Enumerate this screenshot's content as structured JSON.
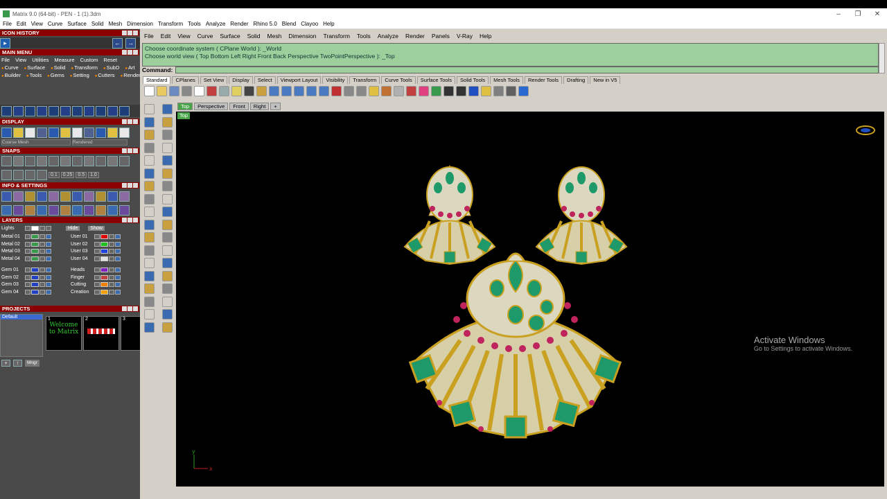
{
  "window": {
    "title": "Matrix 9.0 (64-bit) - PEN - 1 (1).3dm"
  },
  "main_menu_bar": [
    "File",
    "Edit",
    "View",
    "Curve",
    "Surface",
    "Solid",
    "Mesh",
    "Dimension",
    "Transform",
    "Tools",
    "Analyze",
    "Render",
    "Rhino 5.0",
    "Blend",
    "Clayoo",
    "Help"
  ],
  "left_panel": {
    "icon_history": "ICON HISTORY",
    "main_menu": "MAIN MENU",
    "main_menu_row1": [
      "File",
      "View",
      "Utilities",
      "Measure",
      "Custom",
      "Reset"
    ],
    "main_menu_row2": [
      "Curve",
      "Surface",
      "Solid",
      "Transform",
      "SubD",
      "Art"
    ],
    "main_menu_row3": [
      "Builder",
      "Tools",
      "Gems",
      "Setting",
      "Cutters",
      "Render"
    ],
    "display": "DISPLAY",
    "display_mesh": "Coarse Mesh",
    "display_mode": "Rendered",
    "snaps": "SNAPS",
    "snap_values": [
      "0.1",
      "0.25",
      "0.5",
      "1.0"
    ],
    "info_settings": "INFO & SETTINGS",
    "layers": "LAYERS",
    "layer_lights": "Lights",
    "hide": "Hide",
    "show": "Show",
    "layers_left": [
      {
        "name": "Metal 01",
        "color": "#3a9a4c"
      },
      {
        "name": "Metal 02",
        "color": "#3a9a4c"
      },
      {
        "name": "Metal 03",
        "color": "#3a9a4c"
      },
      {
        "name": "Metal 04",
        "color": "#3a9a4c"
      },
      {
        "name": "Gem 01",
        "color": "#2040c0"
      },
      {
        "name": "Gem 02",
        "color": "#2040c0"
      },
      {
        "name": "Gem 03",
        "color": "#2040c0"
      },
      {
        "name": "Gem 04",
        "color": "#2040c0"
      }
    ],
    "layers_right": [
      {
        "name": "User 01",
        "color": "#e00000"
      },
      {
        "name": "User 02",
        "color": "#20c020"
      },
      {
        "name": "User 03",
        "color": "#2040e0"
      },
      {
        "name": "User 04",
        "color": "#e0e0e0"
      },
      {
        "name": "Heads",
        "color": "#8020c0"
      },
      {
        "name": "Finger",
        "color": "#c04040"
      },
      {
        "name": "Cutting",
        "color": "#f08000"
      },
      {
        "name": "Creation",
        "color": "#f0a000"
      }
    ],
    "projects": "PROJECTS",
    "project_default": "Default",
    "project_thumbs": [
      {
        "num": "1",
        "text": "Welcome to Matrix"
      },
      {
        "num": "2",
        "text": ""
      },
      {
        "num": "3",
        "text": ""
      }
    ],
    "mngr": "Mngr"
  },
  "rhino": {
    "menu": [
      "File",
      "Edit",
      "View",
      "Curve",
      "Surface",
      "Solid",
      "Mesh",
      "Dimension",
      "Transform",
      "Tools",
      "Analyze",
      "Render",
      "Panels",
      "V-Ray",
      "Help"
    ],
    "history": [
      "Choose coordinate system ( CPlane  World ): _World",
      "Choose world view ( Top  Bottom  Left  Right  Front  Back  Perspective  TwoPointPerspective ): _Top"
    ],
    "command_label": "Command:",
    "toolbar_tabs": [
      "Standard",
      "CPlanes",
      "Set View",
      "Display",
      "Select",
      "Viewport Layout",
      "Visibility",
      "Transform",
      "Curve Tools",
      "Surface Tools",
      "Solid Tools",
      "Mesh Tools",
      "Render Tools",
      "Drafting",
      "New in V5"
    ],
    "viewport_tabs": [
      "Top",
      "Perspective",
      "Front",
      "Right"
    ],
    "viewport_label": "Top"
  },
  "watermark": {
    "title": "Activate Windows",
    "sub": "Go to Settings to activate Windows."
  },
  "colors": {
    "brand": "#3a9a4c",
    "gold": "#d4b022",
    "emerald": "#1e9a6a",
    "ruby": "#c0245c",
    "diamond": "#e8e8d8"
  }
}
